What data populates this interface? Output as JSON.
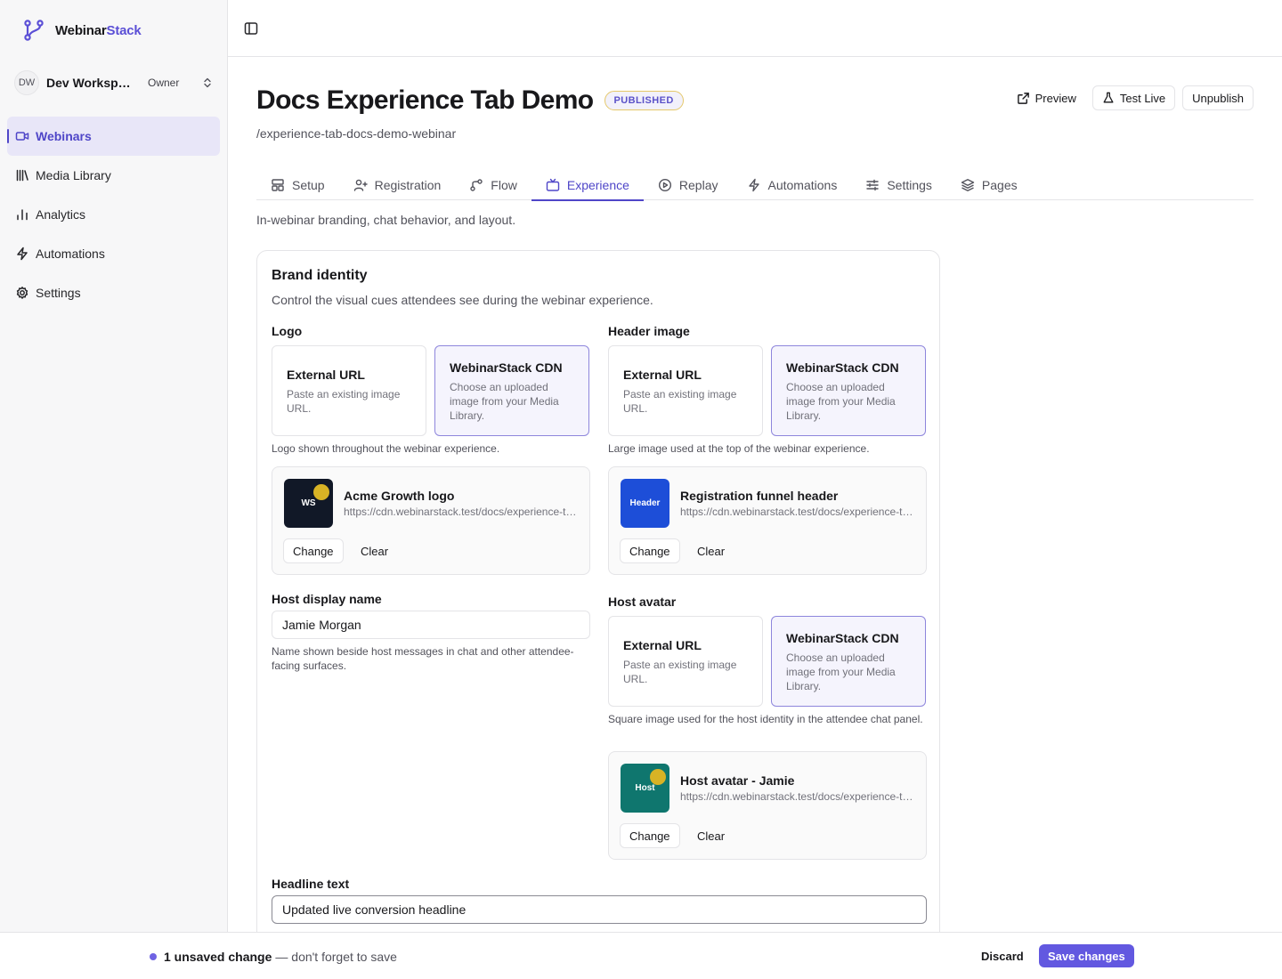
{
  "brand": {
    "name_part1": "Webinar",
    "name_part2": "Stack"
  },
  "workspace": {
    "initials": "DW",
    "name": "Dev Workspace",
    "role": "Owner"
  },
  "nav": [
    {
      "label": "Webinars",
      "icon": "video-icon",
      "active": true
    },
    {
      "label": "Media Library",
      "icon": "library-icon"
    },
    {
      "label": "Analytics",
      "icon": "chart-icon"
    },
    {
      "label": "Automations",
      "icon": "lightning-icon"
    },
    {
      "label": "Settings",
      "icon": "gear-icon"
    }
  ],
  "header": {
    "title": "Docs Experience Tab Demo",
    "status": "PUBLISHED",
    "slug": "/experience-tab-docs-demo-webinar",
    "actions": {
      "preview": "Preview",
      "test_live": "Test Live",
      "unpublish": "Unpublish"
    }
  },
  "tabs": [
    {
      "label": "Setup",
      "icon": "layout-icon"
    },
    {
      "label": "Registration",
      "icon": "user-plus-icon"
    },
    {
      "label": "Flow",
      "icon": "flow-icon"
    },
    {
      "label": "Experience",
      "icon": "tv-icon",
      "active": true
    },
    {
      "label": "Replay",
      "icon": "play-circle-icon"
    },
    {
      "label": "Automations",
      "icon": "lightning-icon"
    },
    {
      "label": "Settings",
      "icon": "sliders-icon"
    },
    {
      "label": "Pages",
      "icon": "layers-icon"
    }
  ],
  "tab_description": "In-webinar branding, chat behavior, and layout.",
  "brand_identity": {
    "title": "Brand identity",
    "subtitle": "Control the visual cues attendees see during the webinar experience.",
    "source_options": {
      "external_title": "External URL",
      "external_desc": "Paste an existing image URL.",
      "cdn_title": "WebinarStack CDN",
      "cdn_desc": "Choose an uploaded image from your Media Library."
    },
    "logo": {
      "label": "Logo",
      "help": "Logo shown throughout the webinar experience.",
      "media_name": "Acme Growth logo",
      "media_url": "https://cdn.webinarstack.test/docs/experience-tab/acme-growth-logo.png",
      "thumb_text": "WS",
      "thumb_color": "#111827"
    },
    "header_image": {
      "label": "Header image",
      "help": "Large image used at the top of the webinar experience.",
      "media_name": "Registration funnel header",
      "media_url": "https://cdn.webinarstack.test/docs/experience-tab/registration-funnel-header.png",
      "thumb_text": "Header",
      "thumb_color": "#1d4ed8"
    },
    "host_display_name": {
      "label": "Host display name",
      "value": "Jamie Morgan",
      "help": "Name shown beside host messages in chat and other attendee-facing surfaces."
    },
    "host_avatar": {
      "label": "Host avatar",
      "help": "Square image used for the host identity in the attendee chat panel.",
      "media_name": "Host avatar - Jamie",
      "media_url": "https://cdn.webinarstack.test/docs/experience-tab/host-avatar-jamie.png",
      "thumb_text": "Host",
      "thumb_color": "#0f766e"
    },
    "headline": {
      "label": "Headline text",
      "value": "Updated live conversion headline"
    },
    "buttons": {
      "change": "Change",
      "clear": "Clear"
    }
  },
  "footer": {
    "unsaved_count": "1 unsaved change",
    "unsaved_hint": "— don't forget to save",
    "discard": "Discard",
    "save": "Save changes"
  },
  "colors": {
    "accent": "#5b4fd6",
    "save_button": "#6258e0",
    "badge_border": "#e5c86a"
  }
}
